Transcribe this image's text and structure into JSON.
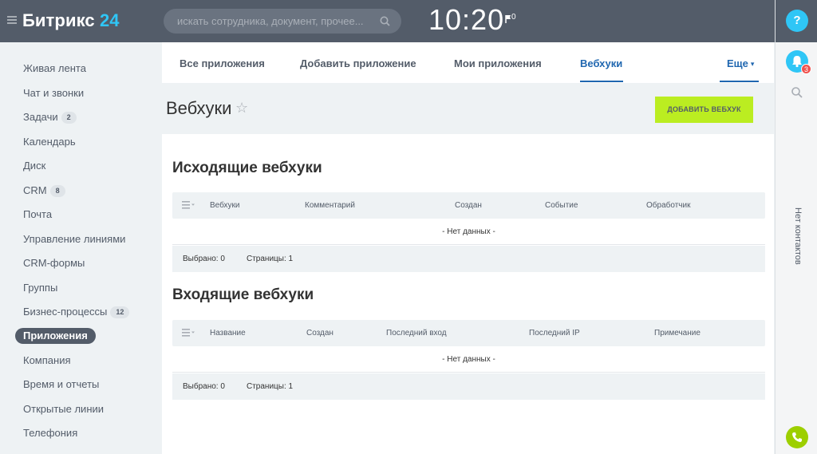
{
  "header": {
    "logo_text": "Битрикс",
    "logo_num": "24",
    "search_placeholder": "искать сотрудника, документ, прочее...",
    "clock": "10:20",
    "flag_count": "0"
  },
  "right_panel": {
    "help_label": "?",
    "notifications_count": "3",
    "no_contacts": "Нет контактов"
  },
  "sidebar": {
    "items": [
      {
        "label": "Живая лента",
        "counter": ""
      },
      {
        "label": "Чат и звонки",
        "counter": ""
      },
      {
        "label": "Задачи",
        "counter": "2"
      },
      {
        "label": "Календарь",
        "counter": ""
      },
      {
        "label": "Диск",
        "counter": ""
      },
      {
        "label": "CRM",
        "counter": "8"
      },
      {
        "label": "Почта",
        "counter": ""
      },
      {
        "label": "Управление линиями",
        "counter": ""
      },
      {
        "label": "CRM-формы",
        "counter": ""
      },
      {
        "label": "Группы",
        "counter": ""
      },
      {
        "label": "Бизнес-процессы",
        "counter": "12"
      },
      {
        "label": "Приложения",
        "counter": "",
        "active": true
      },
      {
        "label": "Компания",
        "counter": ""
      },
      {
        "label": "Время и отчеты",
        "counter": ""
      },
      {
        "label": "Открытые линии",
        "counter": ""
      },
      {
        "label": "Телефония",
        "counter": ""
      }
    ]
  },
  "tabs": [
    {
      "label": "Все приложения"
    },
    {
      "label": "Добавить приложение"
    },
    {
      "label": "Мои приложения"
    },
    {
      "label": "Вебхуки",
      "active": true
    },
    {
      "label": "Еще"
    }
  ],
  "page": {
    "title": "Вебхуки",
    "add_button": "ДОБАВИТЬ ВЕБХУК"
  },
  "outgoing": {
    "title": "Исходящие вебхуки",
    "columns": [
      "Вебхуки",
      "Комментарий",
      "Создан",
      "Событие",
      "Обработчик"
    ],
    "empty": "- Нет данных -",
    "selected": "Выбрано: 0",
    "pages": "Страницы:  1"
  },
  "incoming": {
    "title": "Входящие вебхуки",
    "columns": [
      "Название",
      "Создан",
      "Последний вход",
      "Последний IP",
      "Примечание"
    ],
    "empty": "- Нет данных -",
    "selected": "Выбрано: 0",
    "pages": "Страницы:  1"
  },
  "colors": {
    "header_bg": "#535c69",
    "accent_blue": "#2fc6f6",
    "tab_active": "#2067b0",
    "add_button": "#bbed21",
    "phone_green": "#9dcf00",
    "badge_red": "#f0524e"
  }
}
